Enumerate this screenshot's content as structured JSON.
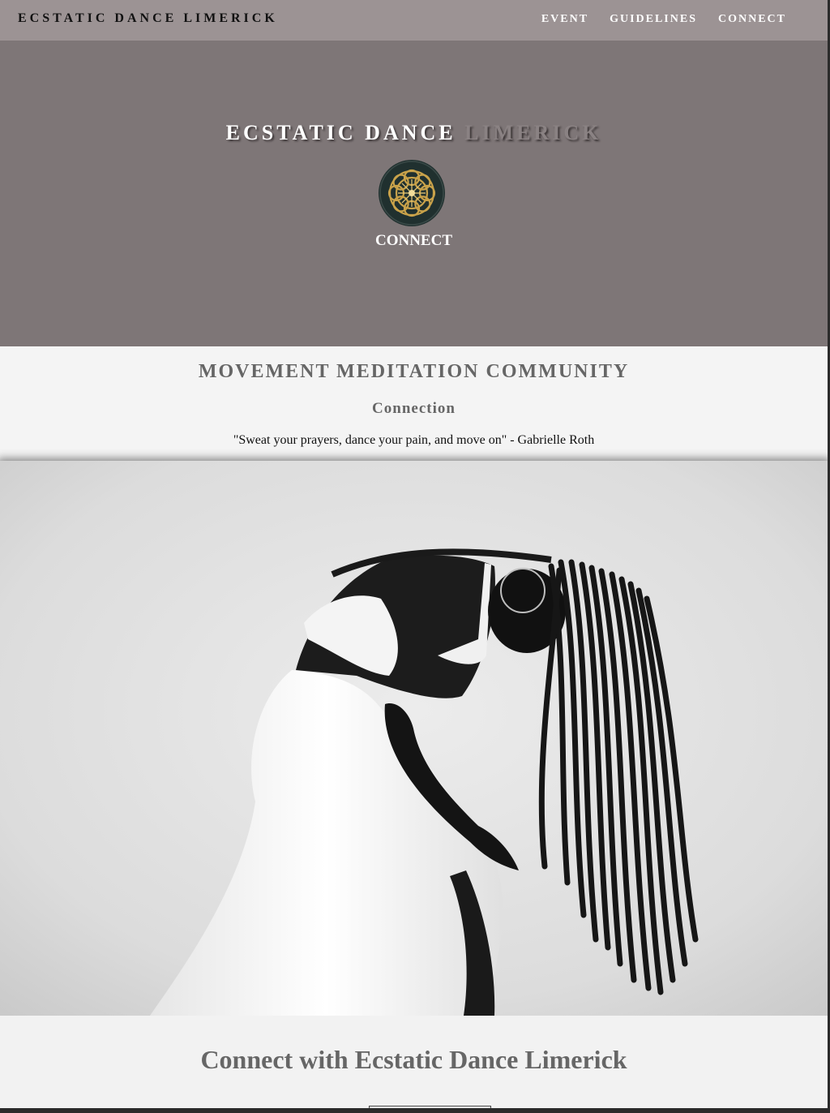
{
  "nav": {
    "brand": "ECSTATIC DANCE LIMERICK",
    "links": [
      "EVENT",
      "GUIDELINES",
      "CONNECT"
    ]
  },
  "hero": {
    "title_part1": "ECSTATIC DANCE",
    "title_part2": "LIMERICK",
    "subtitle": "CONNECT",
    "logo_icon": "mandala-logo-icon"
  },
  "intro": {
    "heading": "MOVEMENT MEDITATION COMMUNITY",
    "subheading": "Connection",
    "quote": "\"Sweat your prayers, dance your pain, and move on\" - Gabrielle Roth"
  },
  "photo": {
    "icon": "dancer-photo"
  },
  "connect": {
    "heading": "Connect with Ecstatic Dance Limerick"
  },
  "colors": {
    "nav_bg": "#9c9394",
    "hero_bg": "#7e7677",
    "heading_gray": "#666666",
    "logo_gold": "#c9a24a",
    "logo_dark": "#1f2f2f"
  }
}
